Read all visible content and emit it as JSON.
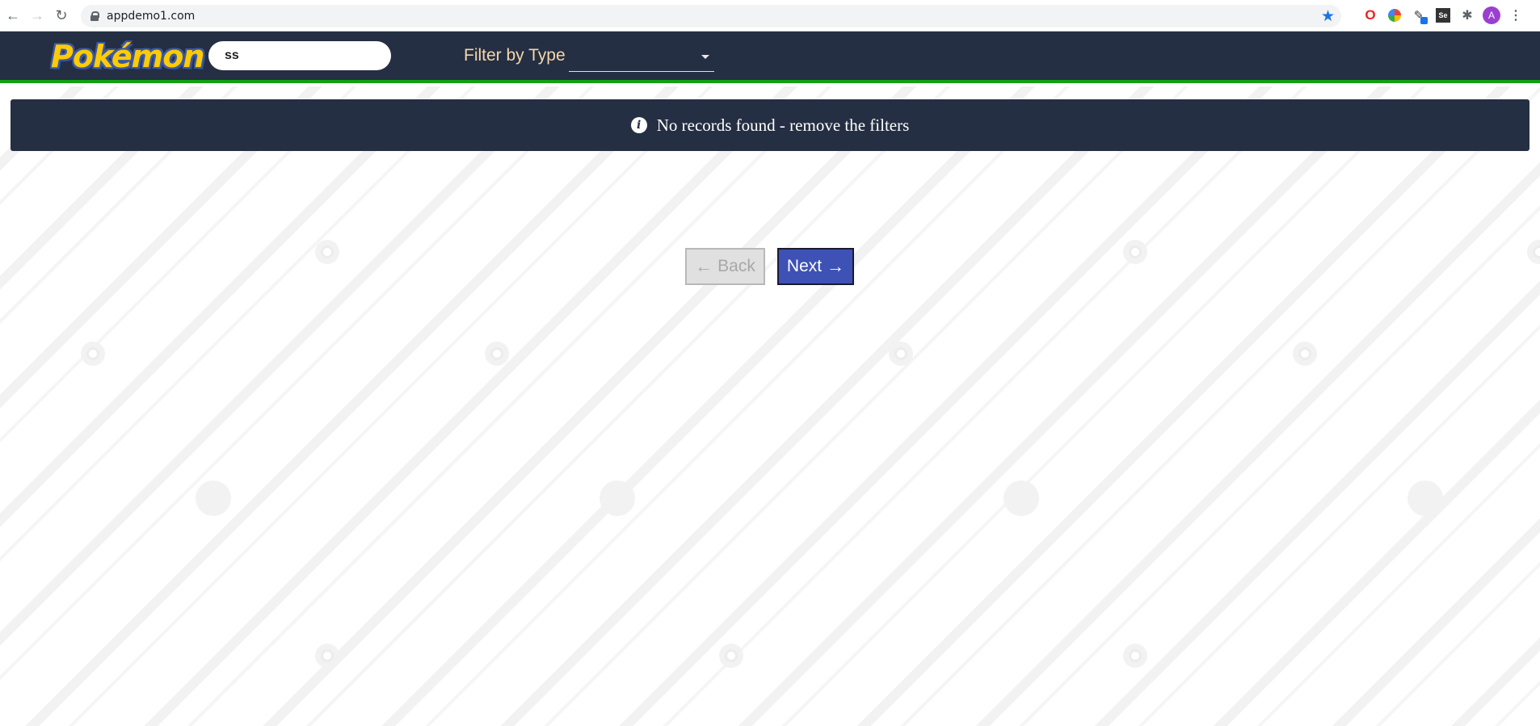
{
  "browser": {
    "url": "appdemo1.com",
    "back_icon": "arrow-left-icon",
    "forward_icon": "arrow-right-icon",
    "reload_icon": "reload-icon",
    "avatar_letter": "A",
    "extensions_se_label": "Se"
  },
  "header": {
    "logo_text": "Pokémon",
    "search": {
      "value": "ss",
      "placeholder": ""
    },
    "filter_label": "Filter by Type",
    "filter_value": ""
  },
  "alert": {
    "icon": "info-icon",
    "message": "No records found - remove the filters"
  },
  "pagination": {
    "back_label": "Back",
    "next_label": "Next",
    "back_disabled": true
  },
  "colors": {
    "header_bg": "#252f43",
    "header_border": "#11a011",
    "next_button": "#3e51b5",
    "filter_label": "#f5d6a8"
  }
}
